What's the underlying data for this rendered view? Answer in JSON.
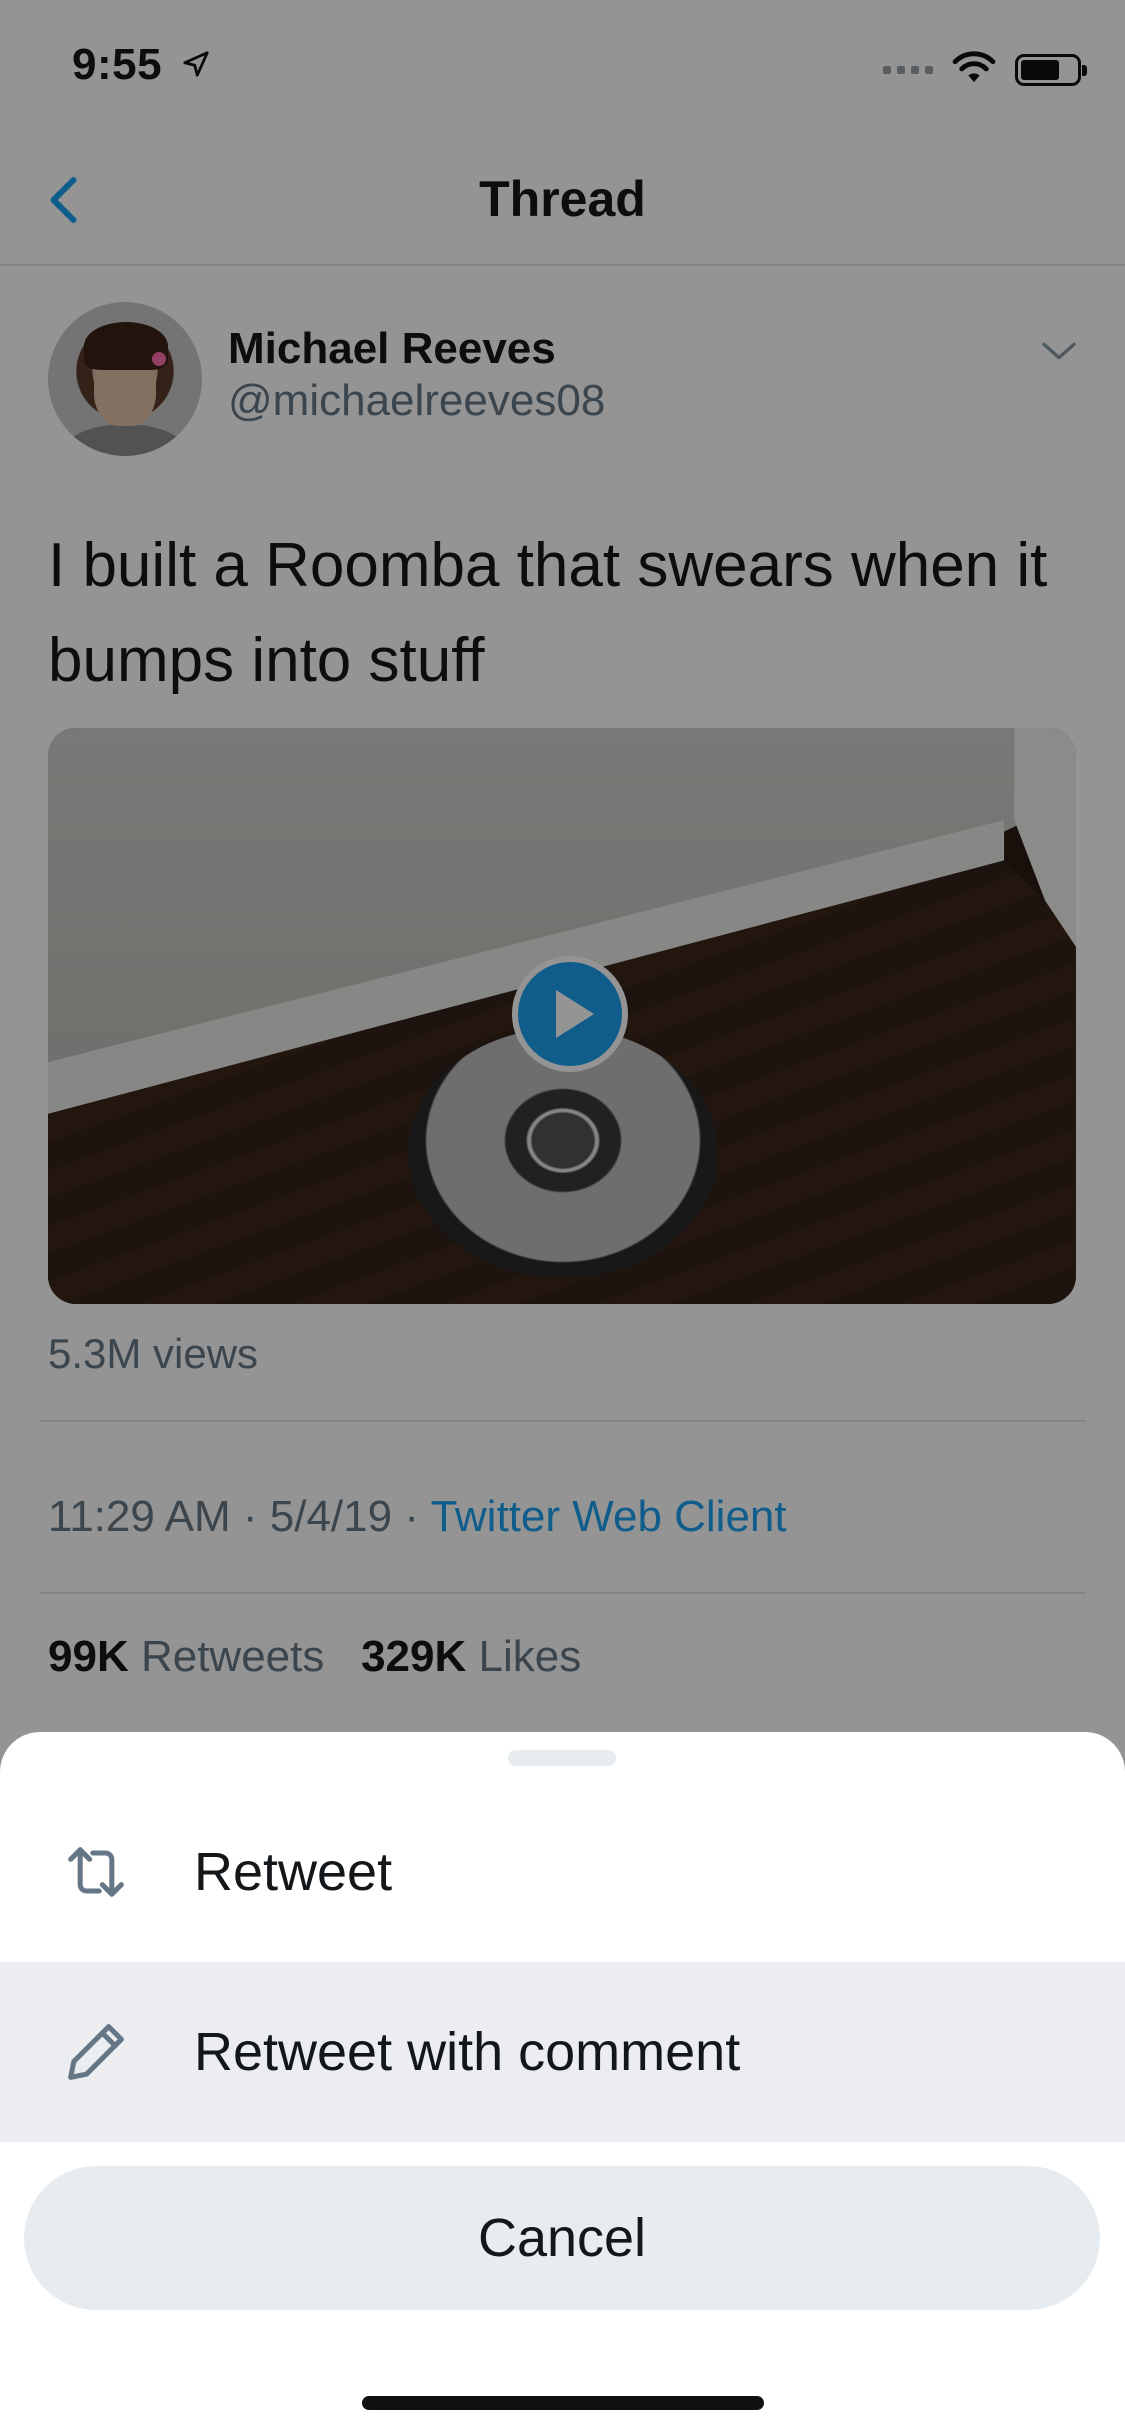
{
  "status_bar": {
    "time": "9:55"
  },
  "nav": {
    "title": "Thread"
  },
  "tweet": {
    "author_name": "Michael Reeves",
    "author_handle": "@michaelreeves08",
    "text": "I built a Roomba that swears when it bumps into stuff",
    "views": "5.3M views",
    "time": "11:29 AM",
    "date": "5/4/19",
    "client": "Twitter Web Client",
    "retweets_count": "99K",
    "retweets_label": "Retweets",
    "likes_count": "329K",
    "likes_label": "Likes"
  },
  "action_sheet": {
    "retweet_label": "Retweet",
    "retweet_comment_label": "Retweet with comment",
    "cancel_label": "Cancel"
  },
  "colors": {
    "accent": "#1da1f2",
    "text": "#14171a",
    "secondary": "#657786"
  }
}
